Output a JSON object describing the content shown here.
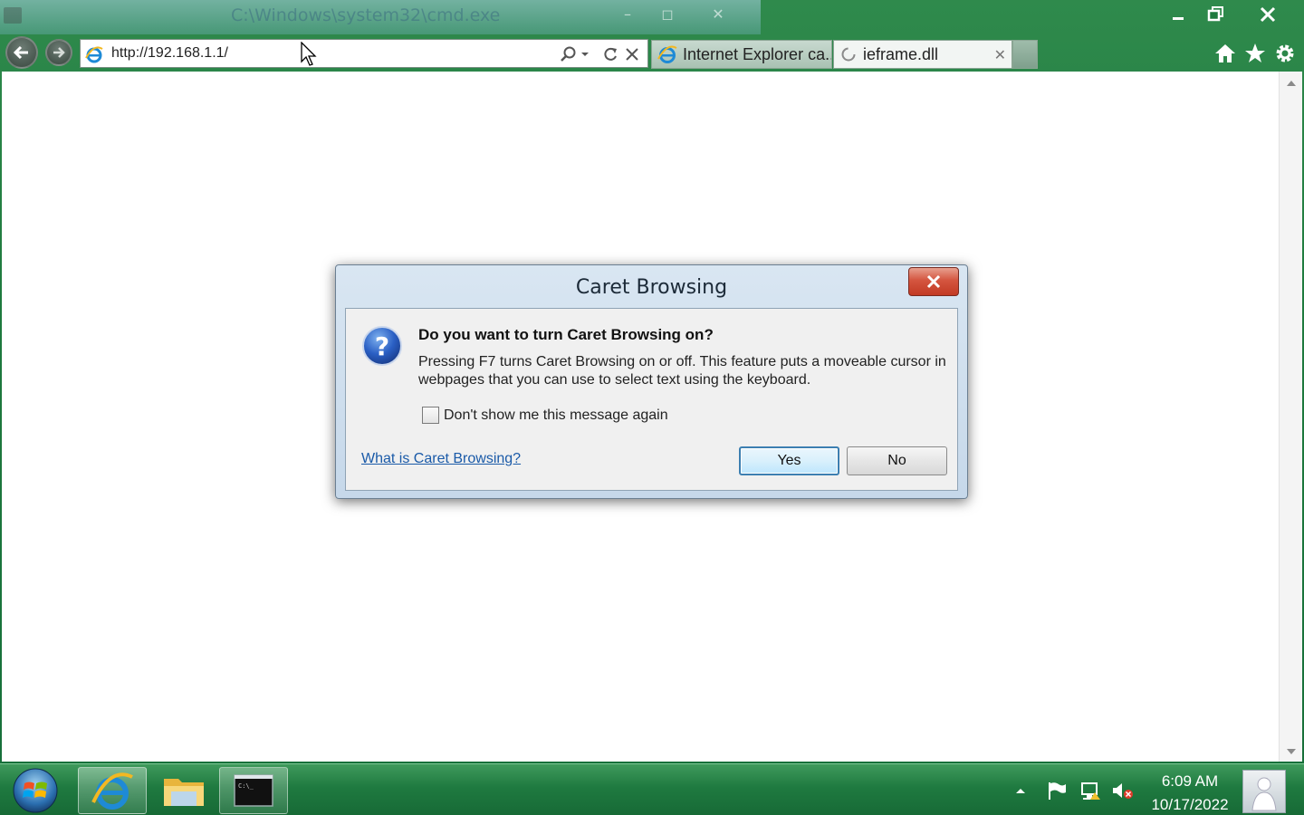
{
  "background_window": {
    "title": "C:\\Windows\\system32\\cmd.exe"
  },
  "browser": {
    "address": "http://192.168.1.1/",
    "tabs": [
      {
        "label": "Internet Explorer ca...",
        "icon": "ie-icon"
      },
      {
        "label": "ieframe.dll",
        "icon": "loading-icon"
      }
    ],
    "toolbar_icons": [
      "home-icon",
      "star-icon",
      "gear-icon"
    ]
  },
  "dialog": {
    "title": "Caret Browsing",
    "heading": "Do you want to turn Caret Browsing on?",
    "description": "Pressing F7 turns Caret Browsing on or off. This feature puts a moveable cursor in webpages that you can use to select text using the keyboard.",
    "checkbox_label": "Don't show me this message again",
    "checkbox_checked": false,
    "help_link": "What is Caret Browsing?",
    "yes_label": "Yes",
    "no_label": "No"
  },
  "taskbar": {
    "time": "6:09 AM",
    "date": "10/17/2022",
    "apps": [
      "internet-explorer",
      "file-explorer",
      "command-prompt"
    ]
  },
  "colors": {
    "frame_green": "#1e7a3e",
    "dialog_close_red": "#c23a24",
    "link_blue": "#1a5aa8"
  }
}
